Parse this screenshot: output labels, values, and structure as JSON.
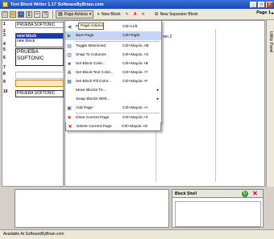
{
  "window": {
    "title": "Text Block Writer 1.17 SoftwareByBrian.com"
  },
  "toolbar": {
    "page_actions": "Page Actions",
    "new_block": "New Block",
    "new_separator": "New Separator Block",
    "page_label": "Page 1"
  },
  "side_panel": {
    "label": "Utility Panel"
  },
  "left_rows": [
    {
      "num": "1",
      "text": "PRUEBA SOFTONIC"
    },
    {
      "num": "2",
      "text": ""
    },
    {
      "num": "3",
      "text": ""
    },
    {
      "num": "4",
      "text": ""
    },
    {
      "num": "5",
      "text": ""
    },
    {
      "num": "6",
      "text": ""
    },
    {
      "num": "7",
      "text": ""
    },
    {
      "num": "8",
      "text": ""
    },
    {
      "num": "9",
      "text": ""
    },
    {
      "num": "10",
      "text": "PRUEBA SOFTONIC"
    }
  ],
  "blocks": {
    "new_block_header": "new block",
    "new_block_body": "new block",
    "prueba_line1": "PRUEBA",
    "prueba_line2": "SOFTONIC"
  },
  "canvas": {
    "column_label": "mn 2"
  },
  "tooltip": "Page Actions",
  "menu": [
    {
      "label": "Previous Page",
      "key": "Ctrl+Left",
      "icon": "arrow-left-icon",
      "glyph": "◀"
    },
    {
      "label": "Next Page",
      "key": "Ctrl+Right",
      "icon": "arrow-right-icon",
      "glyph": "▶"
    },
    {
      "label": "Toggle Minimized",
      "key": "Ctrl+Mayús.+M",
      "icon": "toggle-icon",
      "glyph": "▤"
    },
    {
      "label": "Snap To Columns",
      "key": "Ctrl+Mayús.+G",
      "icon": "columns-icon",
      "glyph": "▥"
    },
    {
      "label": "Set Block Color...",
      "key": "Ctrl+Mayús.+B",
      "icon": "color-icon",
      "glyph": "■"
    },
    {
      "label": "Set Block Text Color...",
      "key": "Ctrl+Mayús.+T",
      "icon": "text-color-icon",
      "glyph": "A"
    },
    {
      "label": "Set Block Fill Color...",
      "key": "Ctrl+Mayús.+F",
      "icon": "fill-color-icon",
      "glyph": "▦"
    },
    {
      "label": "Move Blocks To...",
      "key": "",
      "icon": "",
      "glyph": "",
      "submenu": true
    },
    {
      "label": "Swap Blocks With...",
      "key": "",
      "icon": "",
      "glyph": "",
      "submenu": true
    },
    {
      "label": "Add Page",
      "key": "Ctrl+Mayús.+A",
      "icon": "add-page-icon",
      "glyph": "▣"
    },
    {
      "label": "Clear Current Page",
      "key": "Ctrl+Mayús.+X",
      "icon": "clear-icon",
      "glyph": "✕"
    },
    {
      "label": "Delete Current Page",
      "key": "Ctrl+Mayús.+D",
      "icon": "delete-icon",
      "glyph": "✕"
    }
  ],
  "block_shell": {
    "title": "Block Shell"
  },
  "statusbar": {
    "text": "Available At SoftwareByBrian.com"
  },
  "colors": {
    "title_blue": "#1948b8",
    "header_blue": "#1c3aa8",
    "delete_red": "#d00000"
  }
}
